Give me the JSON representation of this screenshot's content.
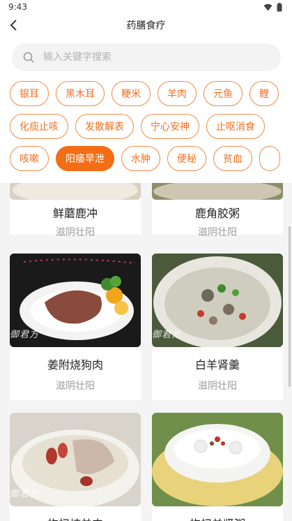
{
  "status": {
    "time": "9:43"
  },
  "header": {
    "title": "药膳食疗"
  },
  "search": {
    "placeholder": "输入关键字搜索"
  },
  "tag_rows": [
    [
      "银耳",
      "黑木耳",
      "粳米",
      "羊肉",
      "元鱼",
      "鲤"
    ],
    [
      "化痰止咳",
      "发散解表",
      "宁心安神",
      "止呕消食"
    ],
    [
      "咳嗽",
      "阳痿早泄",
      "水肿",
      "便秘",
      "贫血",
      ""
    ]
  ],
  "active_tag": "阳痿早泄",
  "recipes": [
    {
      "name": "鲜蘑鹿冲",
      "category": "滋阴壮阳"
    },
    {
      "name": "鹿角胶粥",
      "category": "滋阴壮阳"
    },
    {
      "name": "姜附烧狗肉",
      "category": "滋阴壮阳",
      "watermark": "御君方"
    },
    {
      "name": "白羊肾羹",
      "category": "滋阴壮阳",
      "watermark": "御君方"
    },
    {
      "name": "枸杞炖羊肉",
      "category": "",
      "watermark": "御君方"
    },
    {
      "name": "枸杞羊肾粥",
      "category": "",
      "watermark": ""
    }
  ],
  "colors": {
    "accent": "#f46d14",
    "tag_border": "#f28a44",
    "bg_gray": "#f4f4f4"
  }
}
